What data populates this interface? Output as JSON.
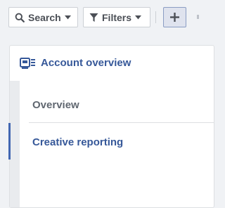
{
  "toolbar": {
    "search_label": "Search",
    "search_icon": "magnifier-icon",
    "filters_label": "Filters",
    "filters_icon": "funnel-icon",
    "caret_icon": "caret-down-icon",
    "add_icon": "plus-icon"
  },
  "panel": {
    "title": "Account overview",
    "title_icon": "dashboard-icon",
    "nav": [
      {
        "label": "Overview",
        "active": false
      },
      {
        "label": "Creative reporting",
        "active": true
      }
    ]
  },
  "colors": {
    "accent": "#365899",
    "active_bar": "#4267b2",
    "background": "#f0f2f5",
    "muted_text": "#606770"
  }
}
